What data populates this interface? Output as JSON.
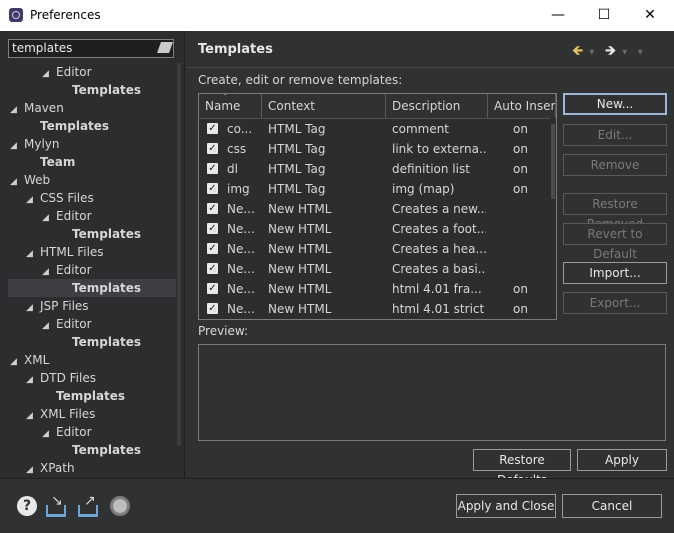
{
  "window": {
    "title": "Preferences",
    "minimize": "—",
    "maximize": "☐",
    "close": "✕"
  },
  "filter": {
    "value": "templates"
  },
  "tree": [
    {
      "label": "Editor",
      "indent": 2,
      "twisty": "◢",
      "bold": false,
      "selected": false
    },
    {
      "label": "Templates",
      "indent": 3,
      "twisty": "",
      "bold": true,
      "selected": false
    },
    {
      "label": "Maven",
      "indent": 0,
      "twisty": "◢",
      "bold": false,
      "selected": false
    },
    {
      "label": "Templates",
      "indent": 1,
      "twisty": "",
      "bold": true,
      "selected": false
    },
    {
      "label": "Mylyn",
      "indent": 0,
      "twisty": "◢",
      "bold": false,
      "selected": false
    },
    {
      "label": "Team",
      "indent": 1,
      "twisty": "",
      "bold": true,
      "selected": false
    },
    {
      "label": "Web",
      "indent": 0,
      "twisty": "◢",
      "bold": false,
      "selected": false
    },
    {
      "label": "CSS Files",
      "indent": 1,
      "twisty": "◢",
      "bold": false,
      "selected": false
    },
    {
      "label": "Editor",
      "indent": 2,
      "twisty": "◢",
      "bold": false,
      "selected": false
    },
    {
      "label": "Templates",
      "indent": 3,
      "twisty": "",
      "bold": true,
      "selected": false
    },
    {
      "label": "HTML Files",
      "indent": 1,
      "twisty": "◢",
      "bold": false,
      "selected": false
    },
    {
      "label": "Editor",
      "indent": 2,
      "twisty": "◢",
      "bold": false,
      "selected": false
    },
    {
      "label": "Templates",
      "indent": 3,
      "twisty": "",
      "bold": true,
      "selected": true
    },
    {
      "label": "JSP Files",
      "indent": 1,
      "twisty": "◢",
      "bold": false,
      "selected": false
    },
    {
      "label": "Editor",
      "indent": 2,
      "twisty": "◢",
      "bold": false,
      "selected": false
    },
    {
      "label": "Templates",
      "indent": 3,
      "twisty": "",
      "bold": true,
      "selected": false
    },
    {
      "label": "XML",
      "indent": 0,
      "twisty": "◢",
      "bold": false,
      "selected": false
    },
    {
      "label": "DTD Files",
      "indent": 1,
      "twisty": "◢",
      "bold": false,
      "selected": false
    },
    {
      "label": "Templates",
      "indent": 2,
      "twisty": "",
      "bold": true,
      "selected": false
    },
    {
      "label": "XML Files",
      "indent": 1,
      "twisty": "◢",
      "bold": false,
      "selected": false
    },
    {
      "label": "Editor",
      "indent": 2,
      "twisty": "◢",
      "bold": false,
      "selected": false
    },
    {
      "label": "Templates",
      "indent": 3,
      "twisty": "",
      "bold": true,
      "selected": false
    },
    {
      "label": "XPath",
      "indent": 1,
      "twisty": "◢",
      "bold": false,
      "selected": false
    }
  ],
  "page": {
    "title": "Templates",
    "nav": {
      "back": "🡸",
      "forward": "🡺",
      "menu": "▾",
      "dropdown": "▾"
    },
    "description": "Create, edit or remove templates:",
    "columns": [
      "Name",
      "Context",
      "Description",
      "Auto Inser"
    ],
    "rows": [
      {
        "checked": true,
        "name": "co...",
        "context": "HTML Tag",
        "description": "comment",
        "auto": "on"
      },
      {
        "checked": true,
        "name": "css",
        "context": "HTML Tag",
        "description": "link to externa...",
        "auto": "on"
      },
      {
        "checked": true,
        "name": "dl",
        "context": "HTML Tag",
        "description": "definition list",
        "auto": "on"
      },
      {
        "checked": true,
        "name": "img",
        "context": "HTML Tag",
        "description": "img     (map)",
        "auto": "on"
      },
      {
        "checked": true,
        "name": "Ne...",
        "context": "New HTML",
        "description": "Creates a new...",
        "auto": ""
      },
      {
        "checked": true,
        "name": "Ne...",
        "context": "New HTML",
        "description": "Creates a foot...",
        "auto": ""
      },
      {
        "checked": true,
        "name": "Ne...",
        "context": "New HTML",
        "description": "Creates a hea...",
        "auto": ""
      },
      {
        "checked": true,
        "name": "Ne...",
        "context": "New HTML",
        "description": "Creates a basi...",
        "auto": ""
      },
      {
        "checked": true,
        "name": "Ne...",
        "context": "New HTML",
        "description": "html 4.01 fra...",
        "auto": "on"
      },
      {
        "checked": true,
        "name": "Ne...",
        "context": "New HTML",
        "description": "html 4.01 strict",
        "auto": "on"
      }
    ],
    "buttons": {
      "new": "New...",
      "edit": "Edit...",
      "remove": "Remove",
      "restore_removed": "Restore Removed",
      "revert_default": "Revert to Default",
      "import": "Import...",
      "export": "Export..."
    },
    "preview_label": "Preview:",
    "restore_defaults": "Restore Defaults",
    "apply": "Apply"
  },
  "footer": {
    "help_icon": "?",
    "apply_close": "Apply and Close",
    "cancel": "Cancel"
  }
}
